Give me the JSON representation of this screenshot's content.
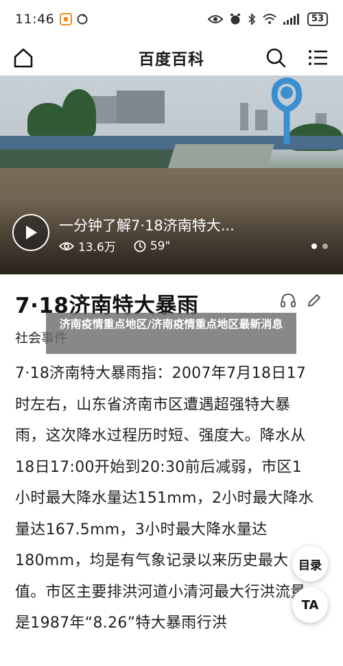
{
  "status_bar": {
    "time": "11:46",
    "battery": "53"
  },
  "header": {
    "title": "百度百科"
  },
  "video": {
    "title": "一分钟了解7·18济南特大...",
    "views": "13.6万",
    "duration": "59\""
  },
  "article": {
    "title": "7·18济南特大暴雨",
    "category": "社会事件",
    "overlay": "济南疫情重点地区/济南疫情重点地区最新消息",
    "body": "7·18济南特大暴雨指：2007年7月18日17时左右，山东省济南市区遭遇超强特大暴雨，这次降水过程历时短、强度大。降水从18日17:00开始到20:30前后减弱，市区1小时最大降水量达151mm，2小时最大降水量达167.5mm，3小时最大降水量达180mm，均是有气象记录以来历史最大值。市区主要排洪河道小清河最大行洪流量是1987年“8.26”特大暴雨行洪"
  },
  "floating": {
    "toc_label": "目录",
    "font_label": "TA"
  }
}
